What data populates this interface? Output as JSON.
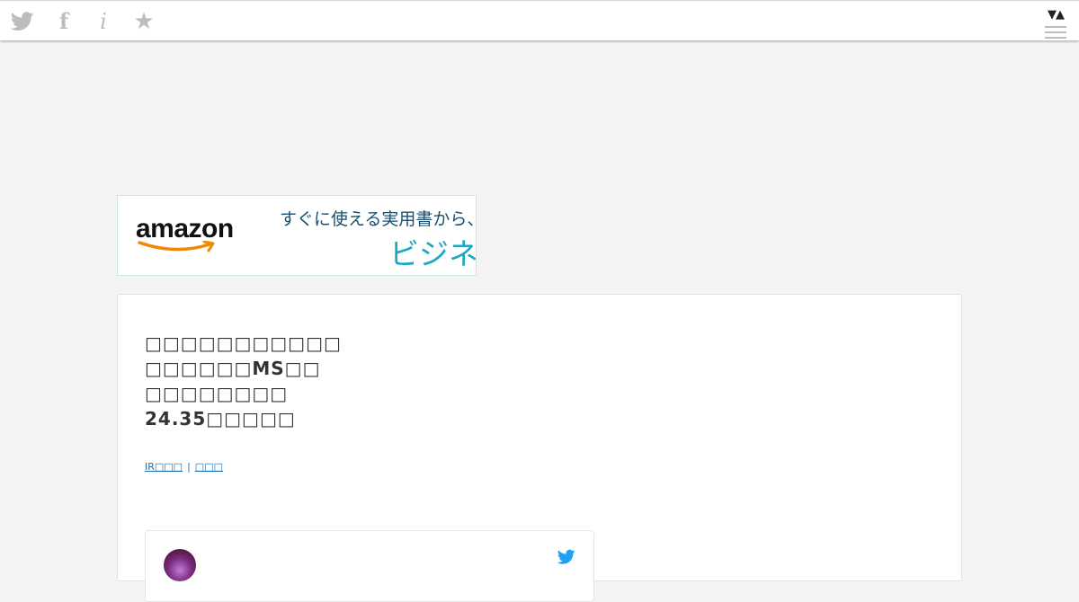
{
  "topbar": {
    "icons": {
      "twitter": "twitter-icon",
      "facebook": "f",
      "info": "i",
      "star": "★"
    },
    "menu_arrows": "▼▲"
  },
  "ad": {
    "brand": "amazon",
    "line1": "すぐに使える実用書から、話",
    "line2": "ビジネス",
    "colors": {
      "line1": "#1a4f6e",
      "line2": "#1ba8c0",
      "smile": "#f08804"
    }
  },
  "article": {
    "title_lines": [
      "□□□□□□□□□□□",
      "□□□□□□MS□□",
      "□□□□□□□□",
      "24.35□□□□□"
    ],
    "tags": [
      "IR□□□",
      "□□□"
    ],
    "tag_separator": "|"
  },
  "tweet": {
    "bird_color": "#1da1f2"
  }
}
